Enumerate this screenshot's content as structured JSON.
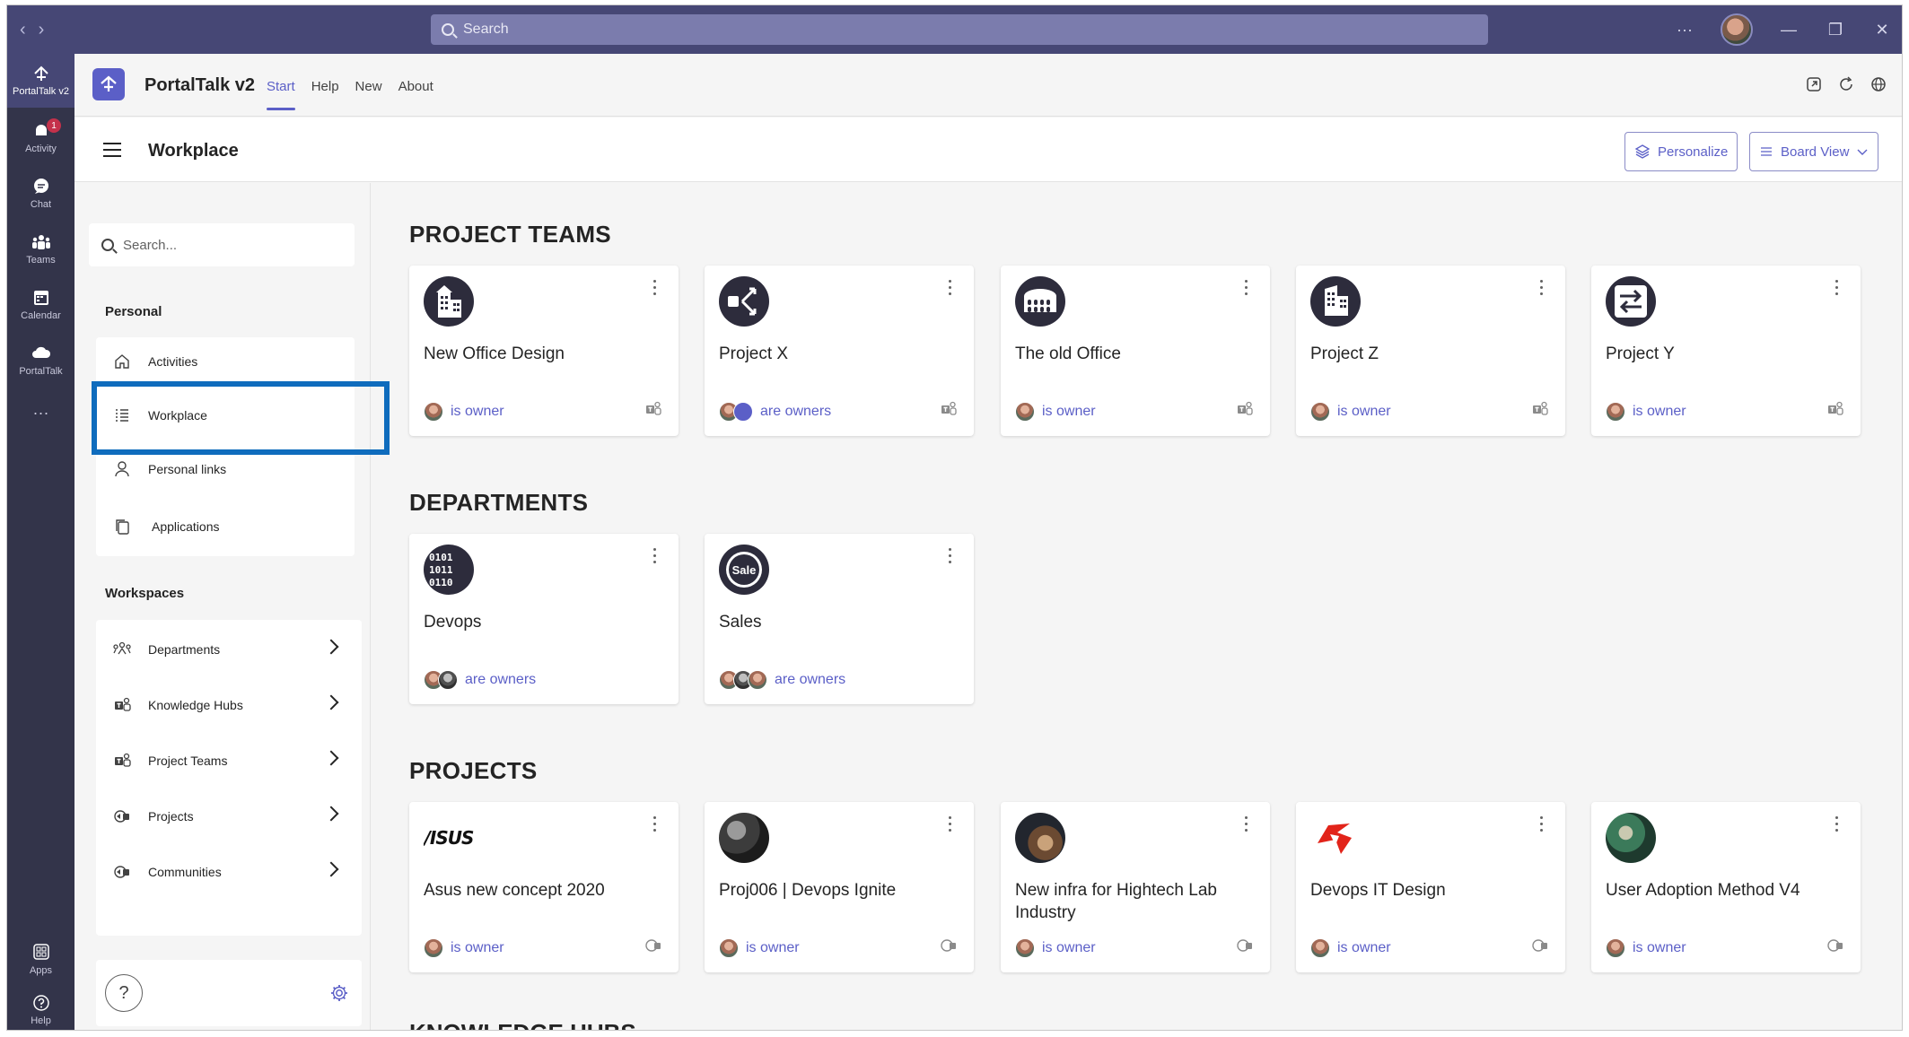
{
  "titlebar": {
    "search_placeholder": "Search",
    "more": "···"
  },
  "rail": [
    {
      "label": "PortalTalk v2",
      "icon": "portaltalk-icon"
    },
    {
      "label": "Activity",
      "icon": "bell-icon",
      "badge": "1"
    },
    {
      "label": "Chat",
      "icon": "chat-icon"
    },
    {
      "label": "Teams",
      "icon": "teams-icon"
    },
    {
      "label": "Calendar",
      "icon": "calendar-icon"
    },
    {
      "label": "PortalTalk",
      "icon": "cloud-icon"
    },
    {
      "label": "Apps",
      "icon": "apps-icon"
    },
    {
      "label": "Help",
      "icon": "help-icon"
    }
  ],
  "app": {
    "title": "PortalTalk v2",
    "tabs": [
      "Start",
      "Help",
      "New",
      "About"
    ]
  },
  "page": {
    "title": "Workplace",
    "personalize": "Personalize",
    "board_view": "Board View"
  },
  "sidebar": {
    "search_placeholder": "Search...",
    "personal_heading": "Personal",
    "personal": [
      "Activities",
      "Workplace",
      "Personal links",
      "Applications"
    ],
    "workspaces_heading": "Workspaces",
    "workspaces": [
      "Departments",
      "Knowledge Hubs",
      "Project Teams",
      "Projects",
      "Communities"
    ],
    "help": "?"
  },
  "sections": {
    "project_teams": {
      "title": "PROJECT TEAMS",
      "cards": [
        {
          "name": "New Office Design",
          "owner": "is owner"
        },
        {
          "name": "Project X",
          "owner": "are owners"
        },
        {
          "name": "The old Office",
          "owner": "is owner"
        },
        {
          "name": "Project Z",
          "owner": "is owner"
        },
        {
          "name": "Project Y",
          "owner": "is owner"
        }
      ]
    },
    "departments": {
      "title": "DEPARTMENTS",
      "cards": [
        {
          "name": "Devops",
          "owner": "are owners"
        },
        {
          "name": "Sales",
          "owner": "are owners",
          "logo_text": "Sale"
        }
      ]
    },
    "projects": {
      "title": "PROJECTS",
      "cards": [
        {
          "name": "Asus new concept 2020",
          "owner": "is owner",
          "logo_text": "/ISUS"
        },
        {
          "name": "Proj006 | Devops Ignite",
          "owner": "is owner"
        },
        {
          "name": "New infra for Hightech Lab Industry",
          "owner": "is owner"
        },
        {
          "name": "Devops IT Design",
          "owner": "is owner"
        },
        {
          "name": "User Adoption Method V4",
          "owner": "is owner"
        }
      ]
    },
    "knowledge_hubs": {
      "title": "KNOWLEDGE HUBS"
    }
  },
  "colors": {
    "titlebar": "#464775",
    "rail": "#33344a",
    "accent": "#5b5fc7",
    "highlight": "#0f6cbd"
  }
}
